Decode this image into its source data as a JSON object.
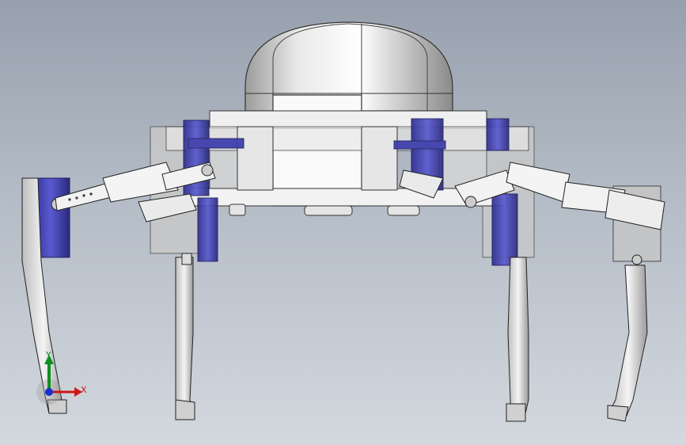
{
  "viewport": {
    "background_top": "#97a0ad",
    "background_bottom": "#d3d8de"
  },
  "model": {
    "name": "hexapod-robot",
    "body_color": "#f0f0f0",
    "servo_color": "#3a3aa8",
    "edge_color": "#2a2a2a"
  },
  "triad": {
    "x_label": "X",
    "y_label": "Y",
    "x_color": "#d01515",
    "y_color": "#0f8f20",
    "z_color": "#1a2fd0"
  }
}
